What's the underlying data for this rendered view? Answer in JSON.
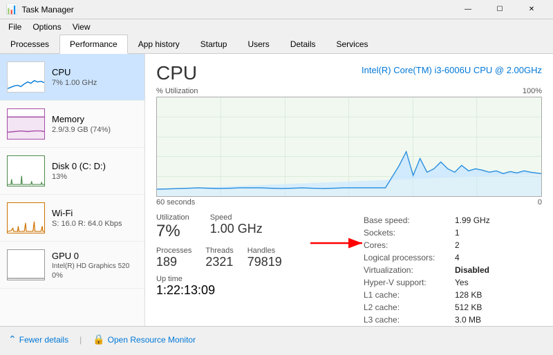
{
  "titlebar": {
    "title": "Task Manager",
    "minimize": "—",
    "maximize": "☐",
    "close": "✕"
  },
  "menubar": {
    "items": [
      "File",
      "Options",
      "View"
    ]
  },
  "tabs": {
    "items": [
      "Processes",
      "Performance",
      "App history",
      "Startup",
      "Users",
      "Details",
      "Services"
    ],
    "active": "Performance"
  },
  "sidebar": {
    "items": [
      {
        "name": "CPU",
        "stat": "7% 1.00 GHz",
        "type": "cpu",
        "active": true
      },
      {
        "name": "Memory",
        "stat": "2.9/3.9 GB (74%)",
        "type": "memory",
        "active": false
      },
      {
        "name": "Disk 0 (C: D:)",
        "stat": "13%",
        "type": "disk",
        "active": false
      },
      {
        "name": "Wi-Fi",
        "stat": "S: 16.0  R: 64.0 Kbps",
        "type": "wifi",
        "active": false
      },
      {
        "name": "GPU 0",
        "stat": "Intel(R) HD Graphics 520\n0%",
        "type": "gpu",
        "active": false
      }
    ]
  },
  "content": {
    "title": "CPU",
    "cpu_model": "Intel(R) Core(TM) i3-6006U CPU @ 2.00GHz",
    "chart": {
      "y_label": "% Utilization",
      "y_max": "100%",
      "time_left": "60 seconds",
      "time_right": "0"
    },
    "stats": {
      "utilization_label": "Utilization",
      "utilization_value": "7%",
      "speed_label": "Speed",
      "speed_value": "1.00 GHz",
      "processes_label": "Processes",
      "processes_value": "189",
      "threads_label": "Threads",
      "threads_value": "2321",
      "handles_label": "Handles",
      "handles_value": "79819",
      "uptime_label": "Up time",
      "uptime_value": "1:22:13:09"
    },
    "details": {
      "rows": [
        {
          "label": "Base speed:",
          "value": "1.99 GHz"
        },
        {
          "label": "Sockets:",
          "value": "1"
        },
        {
          "label": "Cores:",
          "value": "2"
        },
        {
          "label": "Logical processors:",
          "value": "4"
        },
        {
          "label": "Virtualization:",
          "value": "Disabled"
        },
        {
          "label": "Hyper-V support:",
          "value": "Yes"
        },
        {
          "label": "L1 cache:",
          "value": "128 KB"
        },
        {
          "label": "L2 cache:",
          "value": "512 KB"
        },
        {
          "label": "L3 cache:",
          "value": "3.0 MB"
        }
      ]
    }
  },
  "bottombar": {
    "fewer_details": "Fewer details",
    "open_resource_monitor": "Open Resource Monitor"
  },
  "colors": {
    "cpu_line": "#0078d7",
    "cpu_fill": "#cce8ff",
    "memory_line": "#a64ca6",
    "memory_fill": "#f3e5f3",
    "disk_line": "#4d8a4d",
    "disk_fill": "#d4edda",
    "wifi_line": "#cc7000",
    "wifi_fill": "#ffecd1",
    "accent": "#0078d7",
    "active_tab_bg": "white"
  }
}
